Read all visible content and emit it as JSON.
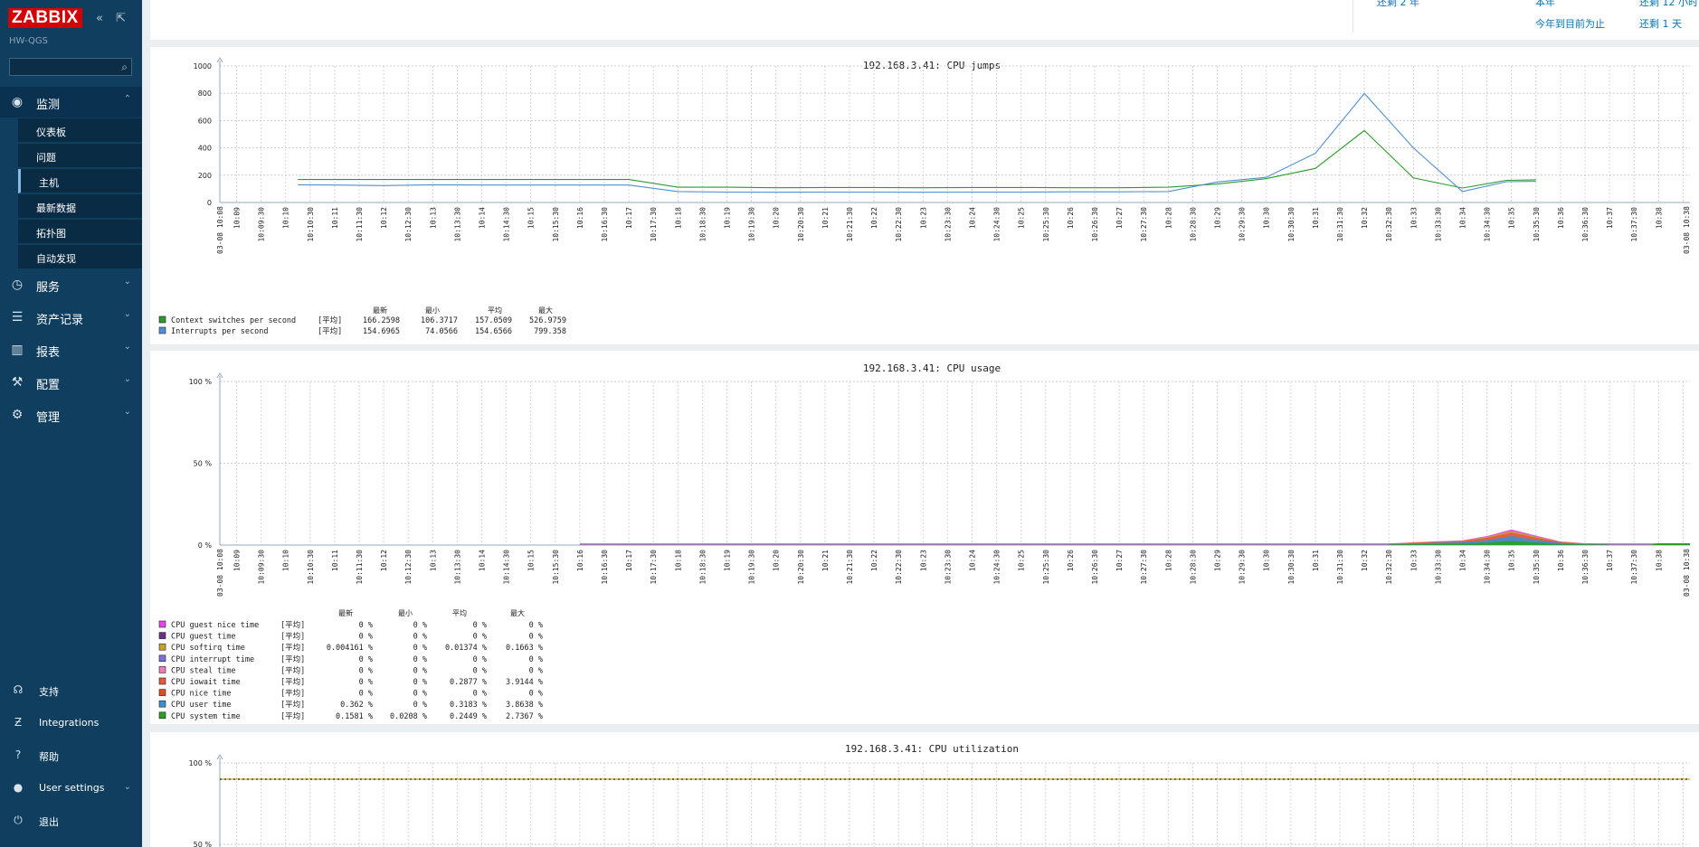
{
  "app": {
    "brand": "ZABBIX",
    "server_name": "HW-QGS"
  },
  "colors": {
    "sidebar": "#0f3e5e",
    "brand": "#d40000",
    "link": "#0275b8",
    "series_green": "#2b9c2b",
    "series_blue": "#4f8fd3",
    "hour_tick": "#e03030"
  },
  "search": {
    "placeholder": ""
  },
  "nav": {
    "main": [
      {
        "label": "监测",
        "icon": "eye-icon",
        "expanded": true
      },
      {
        "label": "服务",
        "icon": "clock-icon"
      },
      {
        "label": "资产记录",
        "icon": "list-icon"
      },
      {
        "label": "报表",
        "icon": "bar-chart-icon"
      },
      {
        "label": "配置",
        "icon": "wrench-icon"
      },
      {
        "label": "管理",
        "icon": "gear-icon"
      }
    ],
    "monitor_sub": [
      {
        "label": "仪表板"
      },
      {
        "label": "问题"
      },
      {
        "label": "主机",
        "selected": true
      },
      {
        "label": "最新数据"
      },
      {
        "label": "拓扑图"
      },
      {
        "label": "自动发现"
      }
    ],
    "bottom": [
      {
        "label": "支持",
        "icon": "headset-icon"
      },
      {
        "label": "Integrations",
        "icon": "z-icon"
      },
      {
        "label": "帮助",
        "icon": "question-icon"
      },
      {
        "label": "User settings",
        "icon": "user-icon"
      },
      {
        "label": "退出",
        "icon": "power-icon"
      }
    ]
  },
  "time_links": {
    "prev_2y": "还剩 2 年",
    "this_year": "本年",
    "prev_12h": "还剩 12 小时",
    "year_to_date": "今年到目前为止",
    "prev_1d": "还剩 1 天"
  },
  "chart_data": [
    {
      "type": "line",
      "title": "192.168.3.41: CPU jumps",
      "ylim": [
        0,
        1000
      ],
      "y_ticks": [
        "1000",
        "800",
        "600",
        "400",
        "200",
        "0"
      ],
      "x_start_label": "03-08 10:08",
      "x_end_label": "03-08 10:38",
      "x_tick_labels": [
        "10:09",
        "10:09:30",
        "10:10",
        "10:10:30",
        "10:11",
        "10:11:30",
        "10:12",
        "10:12:30",
        "10:13",
        "10:13:30",
        "10:14",
        "10:14:30",
        "10:15",
        "10:15:30",
        "10:16",
        "10:16:30",
        "10:17",
        "10:17:30",
        "10:18",
        "10:18:30",
        "10:19",
        "10:19:30",
        "10:20",
        "10:20:30",
        "10:21",
        "10:21:30",
        "10:22",
        "10:22:30",
        "10:23",
        "10:23:30",
        "10:24",
        "10:24:30",
        "10:25",
        "10:25:30",
        "10:26",
        "10:26:30",
        "10:27",
        "10:27:30",
        "10:28",
        "10:28:30",
        "10:29",
        "10:29:30",
        "10:30",
        "10:30:30",
        "10:31",
        "10:31:30",
        "10:32",
        "10:32:30",
        "10:33",
        "10:33:30",
        "10:34",
        "10:34:30",
        "10:35",
        "10:35:30",
        "10:36",
        "10:36:30",
        "10:37",
        "10:37:30",
        "10:38"
      ],
      "series": [
        {
          "name": "Context switches per second",
          "color": "#2b9c2b",
          "agg": "[平均]",
          "last": "166.2598",
          "min": "106.3717",
          "avg": "157.0509",
          "max": "526.9759",
          "points": [
            [
              10.25,
              168
            ],
            [
              11,
              168
            ],
            [
              12,
              168
            ],
            [
              13,
              168
            ],
            [
              14,
              168
            ],
            [
              15,
              168
            ],
            [
              16,
              168
            ],
            [
              17,
              168
            ],
            [
              18,
              112
            ],
            [
              19,
              112
            ],
            [
              20,
              108
            ],
            [
              21,
              110
            ],
            [
              22,
              110
            ],
            [
              23,
              108
            ],
            [
              24,
              110
            ],
            [
              25,
              110
            ],
            [
              26,
              108
            ],
            [
              27,
              108
            ],
            [
              28,
              112
            ],
            [
              29,
              135
            ],
            [
              30,
              175
            ],
            [
              31,
              250
            ],
            [
              32,
              527
            ],
            [
              33,
              180
            ],
            [
              34,
              106
            ],
            [
              34.9,
              162
            ],
            [
              35.5,
              166
            ]
          ]
        },
        {
          "name": "Interrupts per second",
          "color": "#4f8fd3",
          "agg": "[平均]",
          "last": "154.6965",
          "min": "74.0566",
          "avg": "154.6566",
          "max": "799.358",
          "points": [
            [
              10.25,
              130
            ],
            [
              11,
              128
            ],
            [
              12,
              124
            ],
            [
              13,
              130
            ],
            [
              14,
              128
            ],
            [
              15,
              128
            ],
            [
              16,
              128
            ],
            [
              17,
              128
            ],
            [
              18,
              80
            ],
            [
              19,
              76
            ],
            [
              20,
              75
            ],
            [
              21,
              76
            ],
            [
              22,
              76
            ],
            [
              23,
              75
            ],
            [
              24,
              76
            ],
            [
              25,
              76
            ],
            [
              26,
              78
            ],
            [
              27,
              78
            ],
            [
              28,
              80
            ],
            [
              29,
              150
            ],
            [
              30,
              185
            ],
            [
              31,
              360
            ],
            [
              32,
              799
            ],
            [
              33,
              400
            ],
            [
              34,
              80
            ],
            [
              34.9,
              152
            ],
            [
              35.5,
              155
            ]
          ]
        }
      ]
    },
    {
      "type": "area",
      "title": "192.168.3.41: CPU usage",
      "ylim": [
        0,
        100
      ],
      "y_ticks": [
        "100 %",
        "50 %",
        "0 %"
      ],
      "x_start_label": "03-08 10:08",
      "x_end_label": "03-08 10:38",
      "series": [
        {
          "name": "CPU guest nice time",
          "color": "#e845e8",
          "agg": "[平均]",
          "last": "0 %",
          "min": "0 %",
          "avg": "0 %",
          "max": "0 %"
        },
        {
          "name": "CPU guest time",
          "color": "#6b2f88",
          "agg": "[平均]",
          "last": "0 %",
          "min": "0 %",
          "avg": "0 %",
          "max": "0 %"
        },
        {
          "name": "CPU softirq time",
          "color": "#c8a030",
          "agg": "[平均]",
          "last": "0.004161 %",
          "min": "0 %",
          "avg": "0.01374 %",
          "max": "0.1663 %"
        },
        {
          "name": "CPU interrupt time",
          "color": "#7a6fd8",
          "agg": "[平均]",
          "last": "0 %",
          "min": "0 %",
          "avg": "0 %",
          "max": "0 %"
        },
        {
          "name": "CPU steal time",
          "color": "#f07bb5",
          "agg": "[平均]",
          "last": "0 %",
          "min": "0 %",
          "avg": "0 %",
          "max": "0 %"
        },
        {
          "name": "CPU iowait time",
          "color": "#e85a3a",
          "agg": "[平均]",
          "last": "0 %",
          "min": "0 %",
          "avg": "0.2877 %",
          "max": "3.9144 %"
        },
        {
          "name": "CPU nice time",
          "color": "#e84a1f",
          "agg": "[平均]",
          "last": "0 %",
          "min": "0 %",
          "avg": "0 %",
          "max": "0 %"
        },
        {
          "name": "CPU user time",
          "color": "#3f8fcf",
          "agg": "[平均]",
          "last": "0.362 %",
          "min": "0 %",
          "avg": "0.3183 %",
          "max": "3.8638 %"
        },
        {
          "name": "CPU system time",
          "color": "#2b9c2b",
          "agg": "[平均]",
          "last": "0.1581 %",
          "min": "0.0208 %",
          "avg": "0.2449 %",
          "max": "2.7367 %"
        }
      ]
    },
    {
      "type": "line",
      "title": "192.168.3.41: CPU utilization",
      "ylim": [
        0,
        100
      ],
      "y_ticks": [
        "100 %",
        "50 %"
      ],
      "series": []
    }
  ],
  "legend_headers": {
    "last": "最新",
    "min": "最小",
    "avg": "平均",
    "max": "最大"
  }
}
